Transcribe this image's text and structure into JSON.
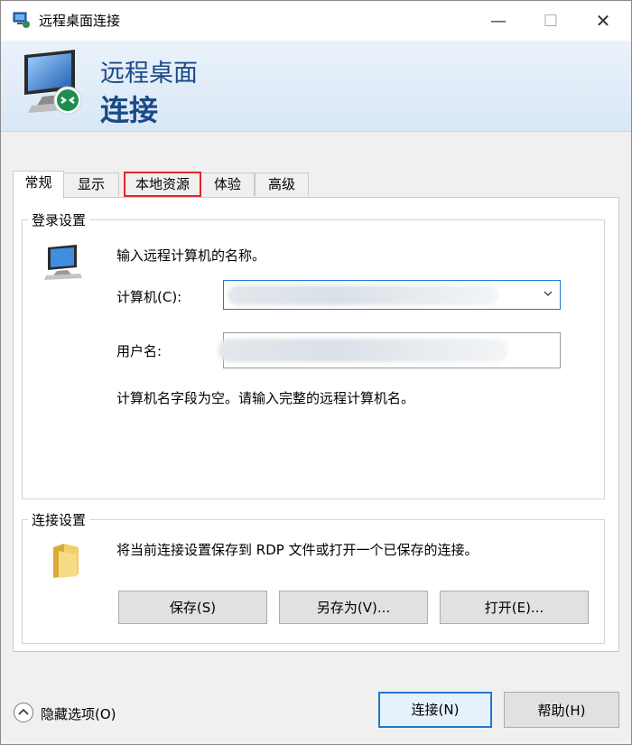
{
  "window": {
    "title": "远程桌面连接",
    "icon": "remote-desktop-icon",
    "controls": {
      "minimize": "—",
      "maximize": "☐",
      "close": "✕"
    }
  },
  "banner": {
    "line1": "远程桌面",
    "line2": "连接",
    "icon": "monitor-connection-icon"
  },
  "tabs": [
    {
      "label": "常规",
      "active": true
    },
    {
      "label": "显示",
      "active": false
    },
    {
      "label": "本地资源",
      "active": false,
      "highlighted": true
    },
    {
      "label": "体验",
      "active": false
    },
    {
      "label": "高级",
      "active": false
    }
  ],
  "login_settings": {
    "caption": "登录设置",
    "hint": "输入远程计算机的名称。",
    "computer_label": "计算机(C):",
    "computer_value": "",
    "username_label": "用户名:",
    "username_value": "",
    "message": "计算机名字段为空。请输入完整的远程计算机名。"
  },
  "connection_settings": {
    "caption": "连接设置",
    "description": "将当前连接设置保存到 RDP 文件或打开一个已保存的连接。",
    "buttons": {
      "save": "保存(S)",
      "save_as": "另存为(V)...",
      "open": "打开(E)..."
    }
  },
  "footer": {
    "hide_options": "隐藏选项(O)",
    "connect": "连接(N)",
    "help": "帮助(H)"
  },
  "colors": {
    "accent": "#1f78d1",
    "highlight_border": "#e3262a",
    "banner_text": "#1a4a85"
  }
}
